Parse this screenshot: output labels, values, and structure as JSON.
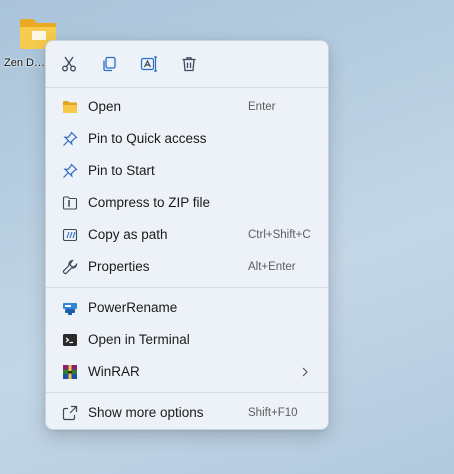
{
  "desktop": {
    "icon_label": "Zen D… Tool"
  },
  "quick_actions": [
    {
      "name": "cut",
      "icon": "scissors-icon"
    },
    {
      "name": "copy",
      "icon": "copy-icon"
    },
    {
      "name": "rename",
      "icon": "rename-icon"
    },
    {
      "name": "delete",
      "icon": "trash-icon"
    }
  ],
  "menu": {
    "open": {
      "label": "Open",
      "shortcut": "Enter",
      "icon": "folder-icon"
    },
    "pin_quick_access": {
      "label": "Pin to Quick access",
      "icon": "pin-icon"
    },
    "pin_start": {
      "label": "Pin to Start",
      "icon": "pin-icon"
    },
    "compress_zip": {
      "label": "Compress to ZIP file",
      "icon": "zip-icon"
    },
    "copy_as_path": {
      "label": "Copy as path",
      "shortcut": "Ctrl+Shift+C",
      "icon": "path-icon"
    },
    "properties": {
      "label": "Properties",
      "shortcut": "Alt+Enter",
      "icon": "wrench-icon"
    },
    "powerrename": {
      "label": "PowerRename",
      "icon": "powerrename-icon"
    },
    "open_terminal": {
      "label": "Open in Terminal",
      "icon": "terminal-icon"
    },
    "winrar": {
      "label": "WinRAR",
      "icon": "winrar-icon"
    },
    "show_more": {
      "label": "Show more options",
      "shortcut": "Shift+F10",
      "icon": "expand-icon"
    }
  },
  "colors": {
    "accent": "#2b6cc4",
    "folder": "#f4c443",
    "menu_bg": "#eef3f9"
  }
}
